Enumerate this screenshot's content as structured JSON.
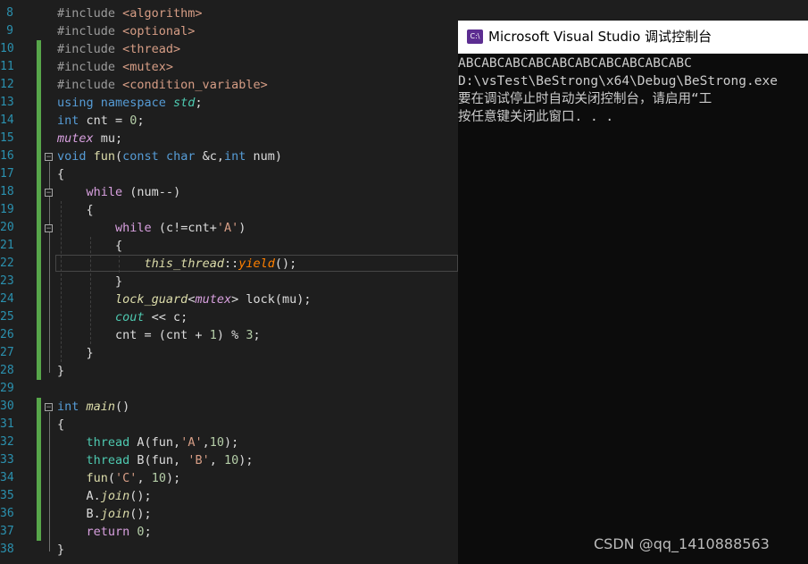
{
  "editor": {
    "line_numbers": [
      "8",
      "9",
      "10",
      "11",
      "12",
      "13",
      "14",
      "15",
      "16",
      "17",
      "18",
      "19",
      "20",
      "21",
      "22",
      "23",
      "24",
      "25",
      "26",
      "27",
      "28",
      "29",
      "30",
      "31",
      "32",
      "33",
      "34",
      "35",
      "36",
      "37",
      "38"
    ],
    "lines": [
      [
        [
          "pp",
          "#include "
        ],
        [
          "str",
          "<algorithm>"
        ]
      ],
      [
        [
          "pp",
          "#include "
        ],
        [
          "str",
          "<optional>"
        ]
      ],
      [
        [
          "pp",
          "#include "
        ],
        [
          "str",
          "<thread>"
        ]
      ],
      [
        [
          "pp",
          "#include "
        ],
        [
          "str",
          "<mutex>"
        ]
      ],
      [
        [
          "pp",
          "#include "
        ],
        [
          "str",
          "<condition_variable>"
        ]
      ],
      [
        [
          "kw",
          "using namespace "
        ],
        [
          "it-ty",
          "std"
        ],
        [
          "",
          "; "
        ]
      ],
      [
        [
          "kw",
          "int "
        ],
        [
          "",
          "cnt = "
        ],
        [
          "num",
          "0"
        ],
        [
          "",
          ";"
        ]
      ],
      [
        [
          "mut",
          "mutex"
        ],
        [
          "",
          " mu;"
        ]
      ],
      [
        [
          "kw",
          "void "
        ],
        [
          "fn",
          "fun"
        ],
        [
          "",
          "("
        ],
        [
          "kw",
          "const char "
        ],
        [
          "",
          "&c,"
        ],
        [
          "kw",
          "int "
        ],
        [
          "",
          "num)"
        ]
      ],
      [
        [
          "",
          "{"
        ]
      ],
      [
        [
          "",
          "    "
        ],
        [
          "ctl",
          "while "
        ],
        [
          "",
          "(num--)"
        ]
      ],
      [
        [
          "",
          "    {"
        ]
      ],
      [
        [
          "",
          "        "
        ],
        [
          "ctl",
          "while "
        ],
        [
          "",
          "(c!=cnt+"
        ],
        [
          "str",
          "'A'"
        ],
        [
          "",
          ")"
        ]
      ],
      [
        [
          "",
          "        {"
        ]
      ],
      [
        [
          "",
          "            "
        ],
        [
          "gld",
          "this_thread"
        ],
        [
          "",
          "::"
        ],
        [
          "yel",
          "yield"
        ],
        [
          "",
          "();"
        ]
      ],
      [
        [
          "",
          "        }"
        ]
      ],
      [
        [
          "",
          "        "
        ],
        [
          "gld",
          "lock_guard"
        ],
        [
          "",
          "<"
        ],
        [
          "mut",
          "mutex"
        ],
        [
          "",
          "> lock(mu);"
        ]
      ],
      [
        [
          "",
          "        "
        ],
        [
          "it-ty",
          "cout"
        ],
        [
          "",
          " << c;"
        ]
      ],
      [
        [
          "",
          "        cnt = (cnt + "
        ],
        [
          "num",
          "1"
        ],
        [
          "",
          ") % "
        ],
        [
          "num",
          "3"
        ],
        [
          "",
          ";"
        ]
      ],
      [
        [
          "",
          "    }"
        ]
      ],
      [
        [
          "",
          "}"
        ]
      ],
      [
        [
          "",
          ""
        ]
      ],
      [
        [
          "kw",
          "int "
        ],
        [
          "gld",
          "main"
        ],
        [
          "",
          "()"
        ]
      ],
      [
        [
          "",
          "{"
        ]
      ],
      [
        [
          "",
          "    "
        ],
        [
          "ty",
          "thread "
        ],
        [
          "",
          "A(fun,"
        ],
        [
          "str",
          "'A'"
        ],
        [
          "",
          ","
        ],
        [
          "num",
          "10"
        ],
        [
          "",
          ");"
        ]
      ],
      [
        [
          "",
          "    "
        ],
        [
          "ty",
          "thread "
        ],
        [
          "",
          "B(fun, "
        ],
        [
          "str",
          "'B'"
        ],
        [
          "",
          ", "
        ],
        [
          "num",
          "10"
        ],
        [
          "",
          ");"
        ]
      ],
      [
        [
          "",
          "    "
        ],
        [
          "fn",
          "fun"
        ],
        [
          "",
          "("
        ],
        [
          "str",
          "'C'"
        ],
        [
          "",
          ", "
        ],
        [
          "num",
          "10"
        ],
        [
          "",
          ");"
        ]
      ],
      [
        [
          "",
          "    A."
        ],
        [
          "gld",
          "join"
        ],
        [
          "",
          "();"
        ]
      ],
      [
        [
          "",
          "    B."
        ],
        [
          "gld",
          "join"
        ],
        [
          "",
          "();"
        ]
      ],
      [
        [
          "",
          "    "
        ],
        [
          "ctl",
          "return "
        ],
        [
          "num",
          "0"
        ],
        [
          "",
          ";"
        ]
      ],
      [
        [
          "",
          "}"
        ]
      ]
    ]
  },
  "console": {
    "title": "Microsoft Visual Studio 调试控制台",
    "icon_label": "C:\\",
    "icon": "visual-studio-console-icon",
    "output_lines": [
      "ABCABCABCABCABCABCABCABCABCABC",
      "D:\\vsTest\\BeStrong\\x64\\Debug\\BeStrong.exe",
      "要在调试停止时自动关闭控制台，请启用“工",
      "按任意键关闭此窗口. . ."
    ]
  },
  "watermark": "CSDN @qq_1410888563",
  "colors": {
    "editor_bg": "#1e1e1e",
    "line_number": "#2b91af",
    "keyword": "#569cd6",
    "type": "#4ec9b0",
    "string": "#d69d85",
    "change_bar": "#57a64a",
    "console_bg": "#0c0c0c"
  }
}
